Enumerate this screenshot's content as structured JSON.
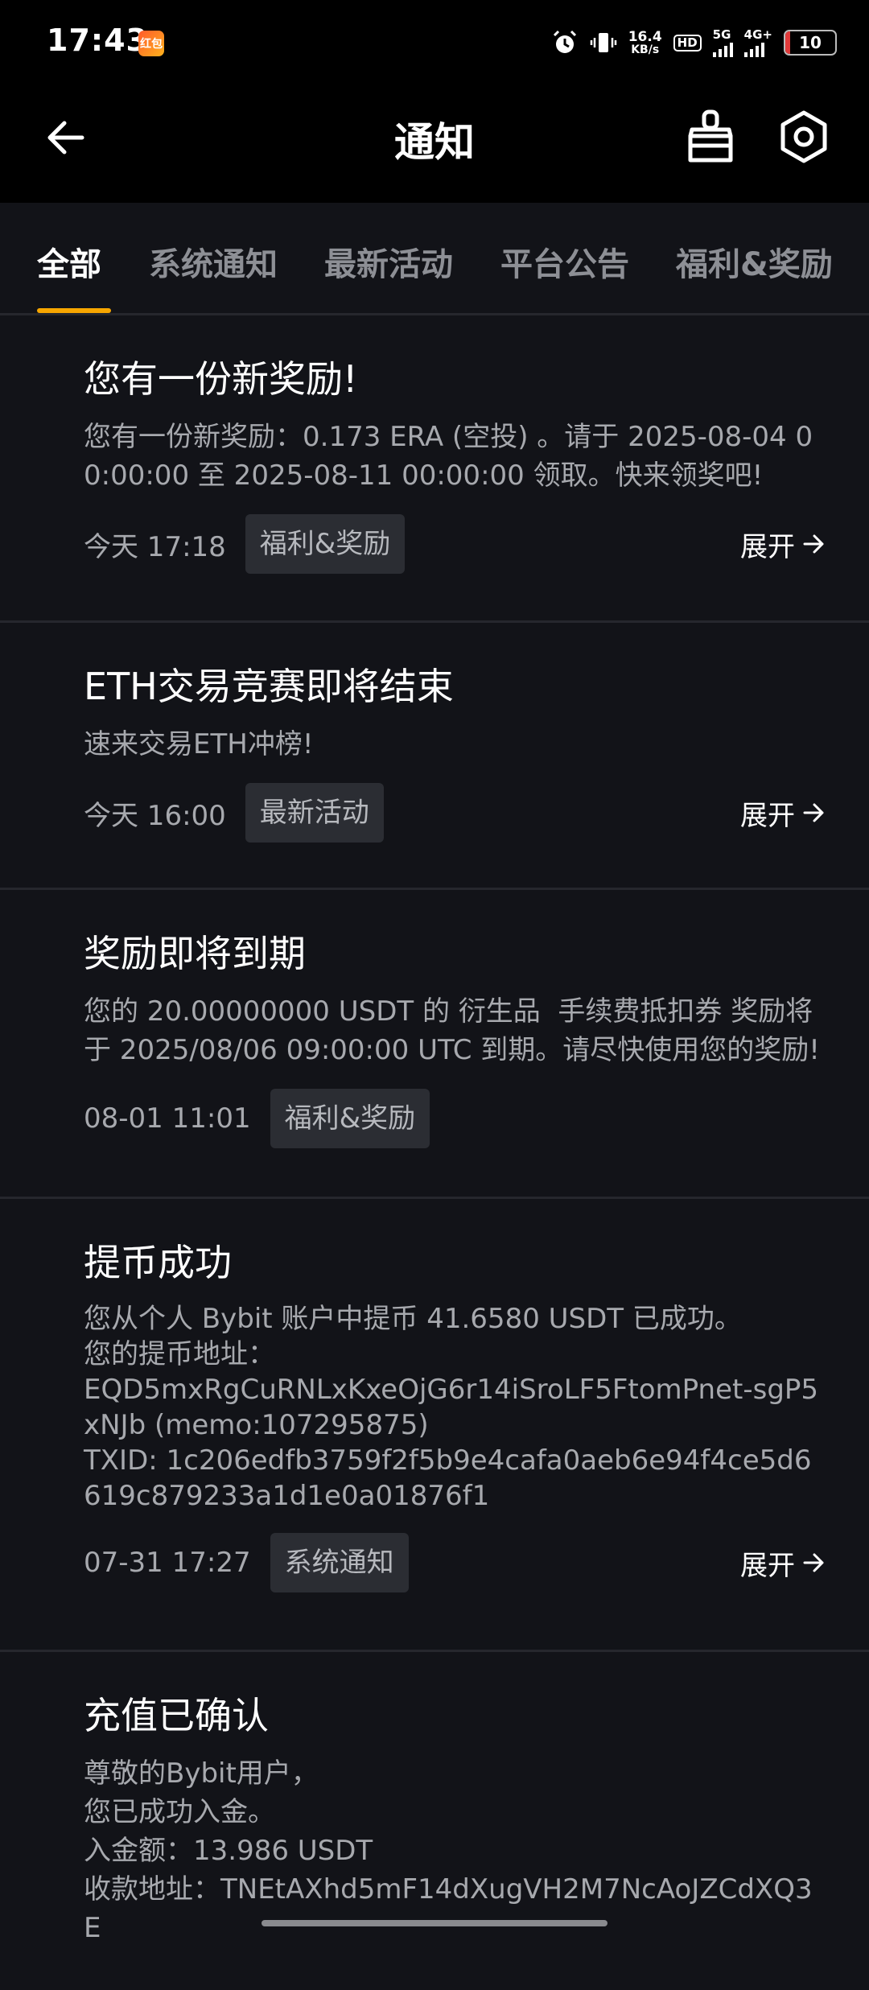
{
  "status_bar": {
    "time": "17:43",
    "app_badge": "红包",
    "net_speed_value": "16.4",
    "net_speed_unit": "KB/s",
    "hd_label": "HD",
    "sim1_label": "5G",
    "sim2_label": "4G+",
    "battery_level": "10"
  },
  "header": {
    "title": "通知"
  },
  "tabs": [
    {
      "label": "全部",
      "active": true
    },
    {
      "label": "系统通知",
      "active": false
    },
    {
      "label": "最新活动",
      "active": false
    },
    {
      "label": "平台公告",
      "active": false
    },
    {
      "label": "福利&奖励",
      "active": false
    }
  ],
  "notifications": [
    {
      "title": "您有一份新奖励!",
      "body": [
        "您有一份新奖励：0.173 ERA (空投) 。请于 2025-08-04 00:00:00 至 2025-08-11 00:00:00 领取。快来领奖吧!"
      ],
      "time": "今天 17:18",
      "tag": "福利&奖励",
      "expand": "展开"
    },
    {
      "title": "ETH交易竞赛即将结束",
      "body": [
        "速来交易ETH冲榜!"
      ],
      "time": "今天 16:00",
      "tag": "最新活动",
      "expand": "展开"
    },
    {
      "title": "奖励即将到期",
      "body": [
        "您的 20.00000000 USDT 的 衍生品  手续费抵扣券 奖励将于 2025/08/06 09:00:00 UTC 到期。请尽快使用您的奖励!"
      ],
      "time": "08-01 11:01",
      "tag": "福利&奖励",
      "expand": ""
    },
    {
      "title": "提币成功",
      "body": [
        "您从个人 Bybit 账户中提币 41.6580 USDT 已成功。",
        "您的提币地址：",
        "EQD5mxRgCuRNLxKxeOjG6r14iSroLF5FtomPnet-sgP5xNJb (memo:107295875)",
        "TXID: 1c206edfb3759f2f5b9e4cafa0aeb6e94f4ce5d6619c879233a1d1e0a01876f1"
      ],
      "time": "07-31 17:27",
      "tag": "系统通知",
      "expand": "展开"
    },
    {
      "title": "充值已确认",
      "body": [
        "尊敬的Bybit用户，",
        "您已成功入金。",
        "入金额：13.986 USDT",
        "收款地址：TNEtAXhd5mF14dXugVH2M7NcAoJZCdXQ3E"
      ],
      "time": "",
      "tag": "",
      "expand": ""
    }
  ]
}
